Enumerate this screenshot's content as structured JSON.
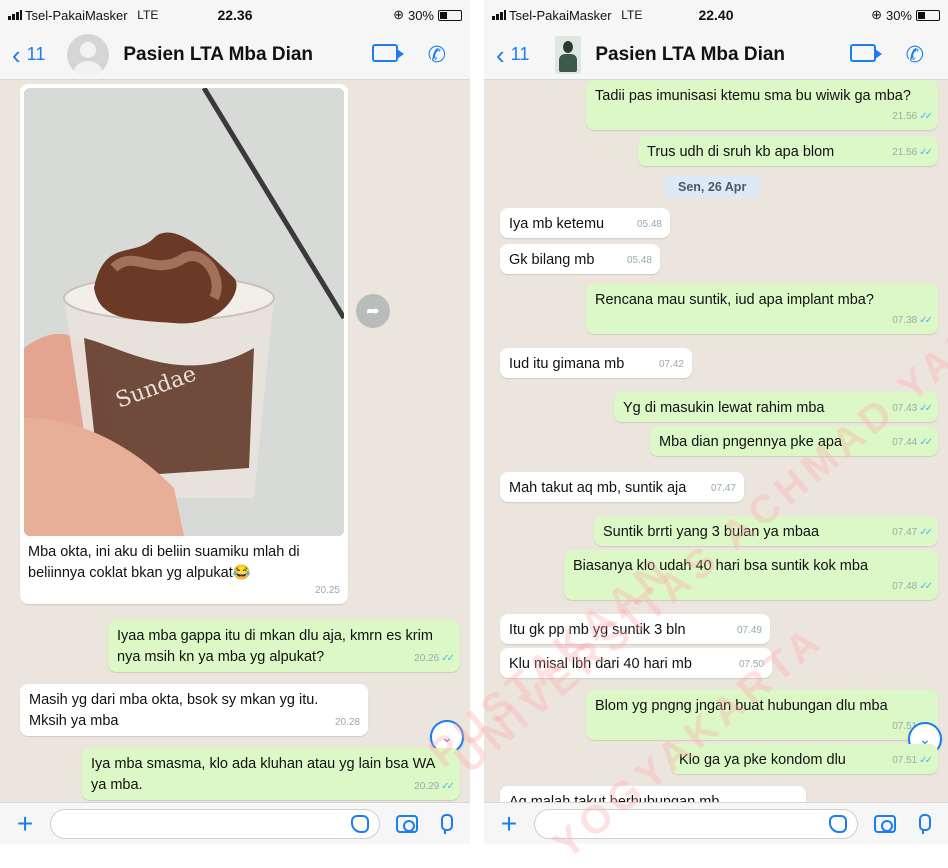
{
  "left": {
    "status": {
      "carrier": "Tsel-PakaiMasker",
      "network": "LTE",
      "time": "22.36",
      "battery": "30%"
    },
    "header": {
      "back_count": "11",
      "name": "Pasien LTA Mba Dian"
    },
    "messages": [
      {
        "text": "Mba okta, ini aku di beliin suamiku mlah di beliinnya coklat bkan yg alpukat😂",
        "time": "20.25"
      },
      {
        "text": "Iyaa mba gappa itu di mkan dlu aja, kmrn es krim nya msih kn ya mba yg alpukat?",
        "time": "20.26"
      },
      {
        "text": "Masih yg dari mba okta, bsok sy mkan yg itu. Mksih ya mba",
        "time": "20.28"
      },
      {
        "text": "Iya mba smasma, klo ada kluhan atau yg lain bsa WA ya mba.",
        "time": "20.29"
      }
    ]
  },
  "right": {
    "status": {
      "carrier": "Tsel-PakaiMasker",
      "network": "LTE",
      "time": "22.40",
      "battery": "30%"
    },
    "header": {
      "back_count": "11",
      "name": "Pasien LTA Mba Dian"
    },
    "date_divider": "Sen, 26 Apr",
    "messages": [
      {
        "text": "Tadii pas imunisasi ktemu sma bu wiwik ga mba?",
        "time": "21.56"
      },
      {
        "text": "Trus udh di sruh kb apa blom",
        "time": "21.56"
      },
      {
        "text": "Iya mb ketemu",
        "time": "05.48"
      },
      {
        "text": "Gk bilang mb",
        "time": "05.48"
      },
      {
        "text": "Rencana mau suntik, iud apa implant mba?",
        "time": "07.38"
      },
      {
        "text": "Iud itu gimana mb",
        "time": "07.42"
      },
      {
        "text": "Yg di masukin lewat rahim mba",
        "time": "07.43"
      },
      {
        "text": "Mba dian pngennya pke apa",
        "time": "07.44"
      },
      {
        "text": "Mah takut aq mb, suntik aja",
        "time": "07.47"
      },
      {
        "text": "Suntik brrti yang 3 bulan ya mbaa",
        "time": "07.47"
      },
      {
        "text": "Biasanya klo udah 40 hari bsa suntik kok mba",
        "time": "07.48"
      },
      {
        "text": "Itu gk pp mb yg suntik 3 bln",
        "time": "07.49"
      },
      {
        "text": "Klu misal lbh dari 40 hari mb",
        "time": "07.50"
      },
      {
        "text": "Blom yg pngng jngan buat hubungan dlu mba",
        "time": "07.51"
      },
      {
        "text": "Klo ga ya pke kondom dlu",
        "time": "07.51"
      },
      {
        "text": "Aq malah takut berhubungan mb",
        "time": ""
      }
    ]
  },
  "watermark": {
    "line1": "PUSTAKAAN",
    "line2": "UNIVERSITAS ACHMAD YANI",
    "line3": "YOGYAKARTA"
  },
  "colors": {
    "accent": "#1a7df2",
    "outgoing": "#dcf8c6",
    "incoming": "#ffffff",
    "chat_bg": "#ece5dd"
  }
}
